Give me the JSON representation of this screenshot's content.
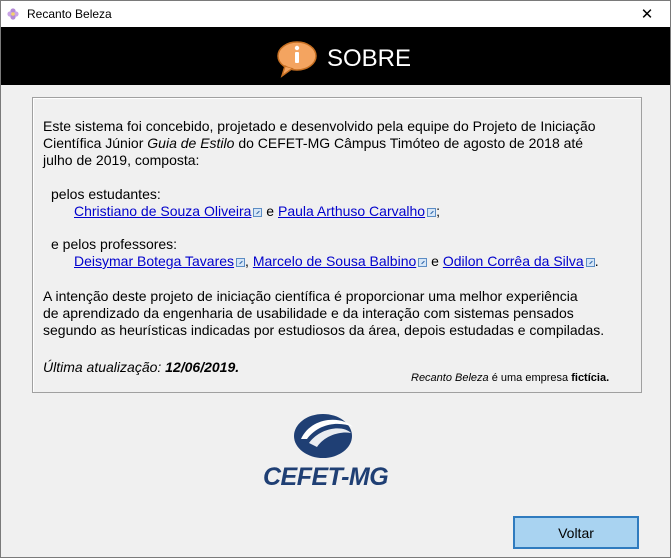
{
  "window": {
    "title": "Recanto Beleza",
    "close_glyph": "✕"
  },
  "banner": {
    "title": "SOBRE",
    "icon": "info-speech-bubble-icon"
  },
  "content": {
    "intro_line1": "Este sistema foi concebido, projetado e desenvolvido pela equipe do Projeto de Iniciação",
    "intro_line2_a": "Científica Júnior ",
    "intro_line2_em": "Guia de Estilo",
    "intro_line2_b": " do CEFET-MG Câmpus Timóteo de agosto de 2018 até",
    "intro_line3": "julho de 2019, composta:",
    "students_label": "pelos estudantes:",
    "students": [
      "Christiano de Souza Oliveira",
      "Paula Arthuso Carvalho"
    ],
    "students_sep": " e ",
    "students_end": ";",
    "professors_label": "e pelos professores:",
    "professors": [
      "Deisymar Botega Tavares",
      "Marcelo de Sousa Balbino",
      "Odilon Corrêa da Silva"
    ],
    "prof_sep1": ", ",
    "prof_sep2": " e ",
    "prof_end": ".",
    "goal_line1": "A intenção deste projeto de iniciação científica é proporcionar uma melhor experiência",
    "goal_line2": "de aprendizado da engenharia de usabilidade e da interação com sistemas pensados",
    "goal_line3": "segundo as heurísticas indicadas por estudiosos da área, depois estudadas e compiladas.",
    "update_label": "Última atualização: ",
    "update_date": "12/06/2019.",
    "disclaimer_brand": "Recanto Beleza",
    "disclaimer_mid": " é uma empresa ",
    "disclaimer_end": "fictícia."
  },
  "logo": {
    "text": "CEFET-MG",
    "brand_color": "#1f3f74"
  },
  "footer": {
    "back_button": "Voltar"
  },
  "colors": {
    "banner_bg": "#000000",
    "link": "#0000cc",
    "button_bg": "#a9d3f1",
    "button_border": "#2f7bbf"
  }
}
